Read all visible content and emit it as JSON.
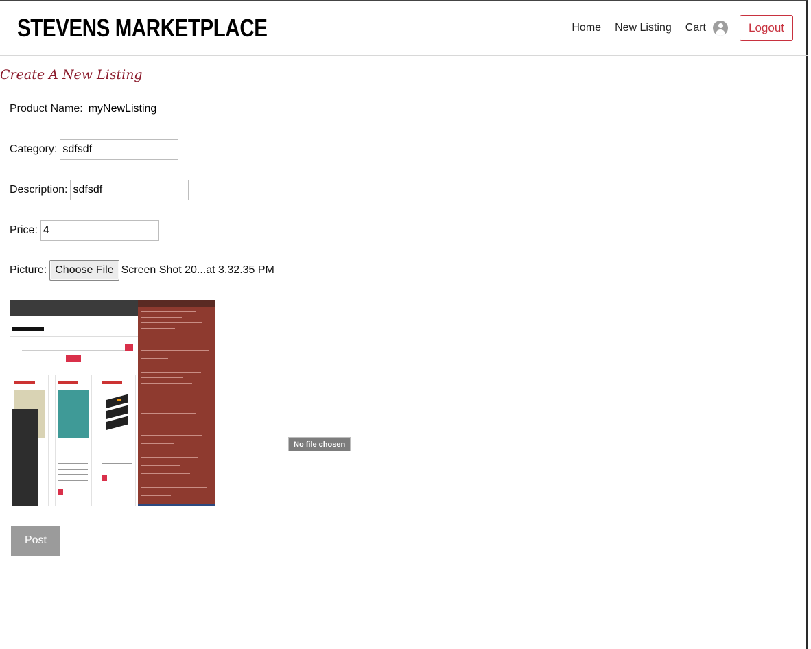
{
  "header": {
    "brand": "STEVENS MARKETPLACE",
    "nav": {
      "home": "Home",
      "new_listing": "New Listing",
      "cart": "Cart",
      "avatar_icon": "user-avatar-icon",
      "logout": "Logout"
    }
  },
  "page": {
    "title": "Create A New Listing"
  },
  "form": {
    "product_name": {
      "label": "Product Name:",
      "value": "myNewListing"
    },
    "category": {
      "label": "Category:",
      "value": "sdfsdf"
    },
    "description": {
      "label": "Description:",
      "value": "sdfsdf"
    },
    "price": {
      "label": "Price:",
      "value": "4"
    },
    "picture": {
      "label": "Picture:",
      "button": "Choose File",
      "file_name": "Screen Shot 20...at 3.32.35 PM",
      "tooltip": "No file chosen"
    },
    "submit": "Post"
  },
  "colors": {
    "accent": "#c8323f",
    "title": "#8b1a2b",
    "post_button": "#9b9b9b"
  }
}
